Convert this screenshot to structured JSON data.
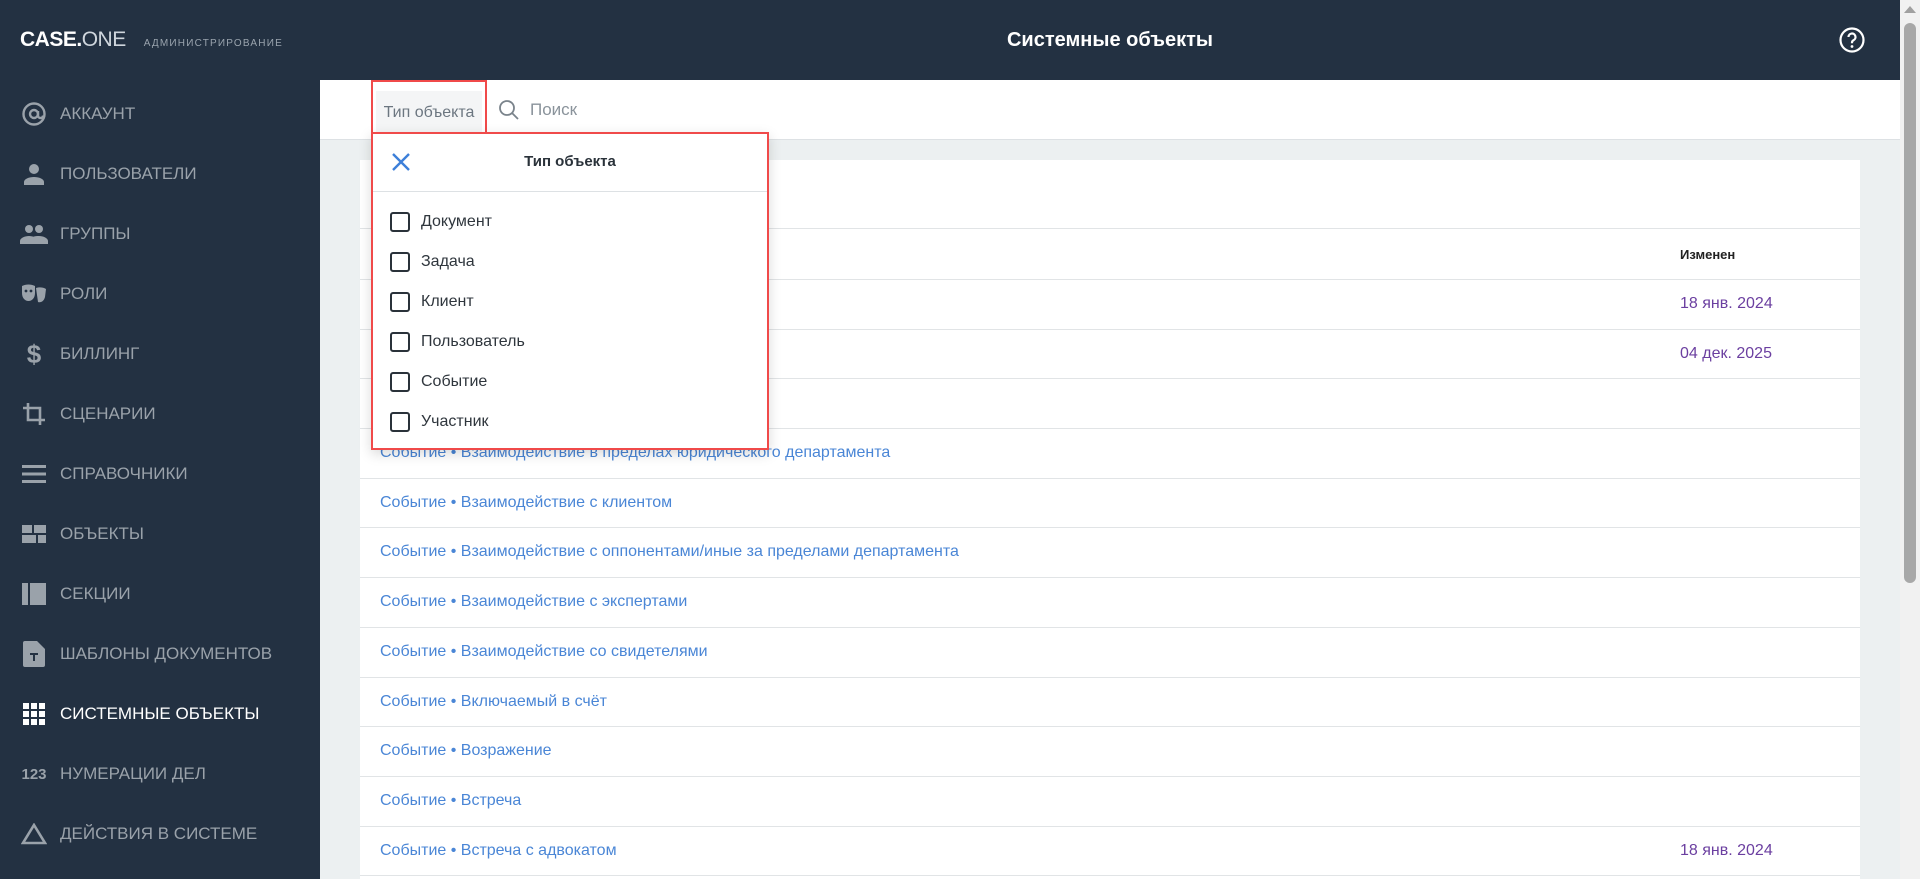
{
  "app": {
    "brand_bold": "CASE.",
    "brand_light": "ONE",
    "subtitle": "АДМИНИСТРИРОВАНИЕ"
  },
  "header": {
    "title": "Системные объекты",
    "help_icon": "help-circle-icon"
  },
  "sidebar": {
    "items": [
      {
        "label": "АККАУНТ",
        "icon": "at-icon"
      },
      {
        "label": "ПОЛЬЗОВАТЕЛИ",
        "icon": "user-icon"
      },
      {
        "label": "ГРУППЫ",
        "icon": "group-icon"
      },
      {
        "label": "РОЛИ",
        "icon": "theater-masks-icon"
      },
      {
        "label": "БИЛЛИНГ",
        "icon": "dollar-icon"
      },
      {
        "label": "СЦЕНАРИИ",
        "icon": "crop-icon"
      },
      {
        "label": "СПРАВОЧНИКИ",
        "icon": "list-icon"
      },
      {
        "label": "ОБЪЕКТЫ",
        "icon": "dashboard-icon"
      },
      {
        "label": "СЕКЦИИ",
        "icon": "sections-icon"
      },
      {
        "label": "ШАБЛОНЫ ДОКУМЕНТОВ",
        "icon": "document-template-icon"
      },
      {
        "label": "СИСТЕМНЫЕ ОБЪЕКТЫ",
        "icon": "grid-icon",
        "active": true
      },
      {
        "label": "НУМЕРАЦИИ ДЕЛ",
        "icon": "numbers-icon",
        "icon_text": "123"
      },
      {
        "label": "ДЕЙСТВИЯ В СИСТЕМЕ",
        "icon": "triangle-icon"
      }
    ]
  },
  "toolbar": {
    "filter_label": "Тип объекта",
    "search_placeholder": "Поиск"
  },
  "table": {
    "col_modified": "Изменен",
    "rows": [
      {
        "name": "",
        "date": "18 янв. 2024"
      },
      {
        "name": "",
        "date": "04 дек. 2025"
      },
      {
        "name": "",
        "date": ""
      },
      {
        "name": "Событие • Взаимодействие в пределах юридического департамента",
        "date": ""
      },
      {
        "name": "Событие • Взаимодействие с клиентом",
        "date": ""
      },
      {
        "name": "Событие • Взаимодействие с оппонентами/иные за пределами департамента",
        "date": ""
      },
      {
        "name": "Событие • Взаимодействие с экспертами",
        "date": ""
      },
      {
        "name": "Событие • Взаимодействие со свидетелями",
        "date": ""
      },
      {
        "name": "Событие • Включаемый в счёт",
        "date": ""
      },
      {
        "name": "Событие • Возражение",
        "date": ""
      },
      {
        "name": "Событие • Встреча",
        "date": ""
      },
      {
        "name": "Событие • Встреча с адвокатом",
        "date": "18 янв. 2024"
      }
    ]
  },
  "dropdown": {
    "title": "Тип объекта",
    "options": [
      {
        "label": "Документ",
        "checked": false
      },
      {
        "label": "Задача",
        "checked": false
      },
      {
        "label": "Клиент",
        "checked": false
      },
      {
        "label": "Пользователь",
        "checked": false
      },
      {
        "label": "Событие",
        "checked": false
      },
      {
        "label": "Участник",
        "checked": false
      }
    ]
  },
  "colors": {
    "sidebar": "#233142",
    "link": "#4a86d6",
    "date": "#6b3fa0",
    "highlight": "#f04a4a"
  }
}
